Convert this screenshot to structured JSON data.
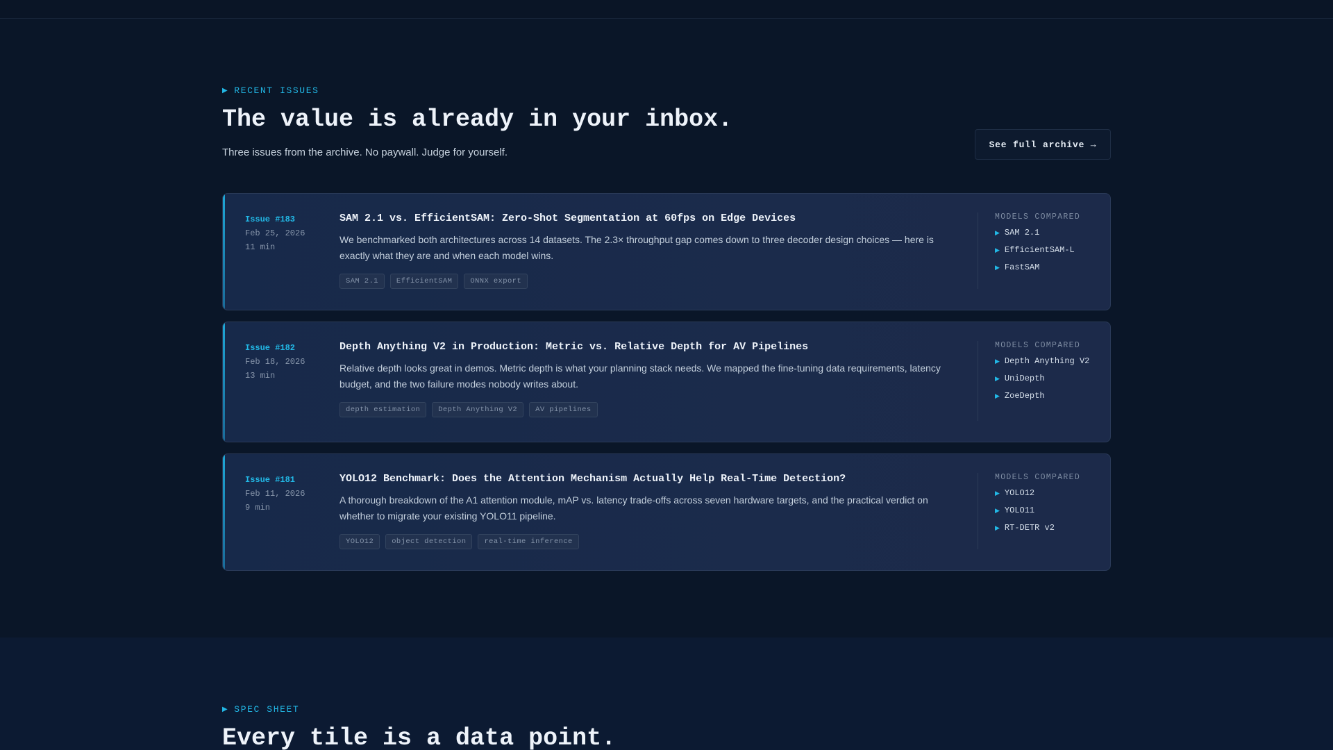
{
  "issues_section": {
    "eyebrow": "RECENT ISSUES",
    "headline": "The value is already in your inbox.",
    "subhead": "Three issues from the archive. No paywall. Judge for yourself.",
    "archive_button": "See full archive →",
    "models_header": "MODELS COMPARED",
    "cards": [
      {
        "issue": "Issue #183",
        "date": "Feb 25, 2026",
        "read_time": "11 min",
        "title": "SAM 2.1 vs. EfficientSAM: Zero-Shot Segmentation at 60fps on Edge Devices",
        "description": "We benchmarked both architectures across 14 datasets. The 2.3× throughput gap comes down to three decoder design choices — here is exactly what they are and when each model wins.",
        "tags": [
          "SAM 2.1",
          "EfficientSAM",
          "ONNX export"
        ],
        "models": [
          "SAM 2.1",
          "EfficientSAM-L",
          "FastSAM"
        ]
      },
      {
        "issue": "Issue #182",
        "date": "Feb 18, 2026",
        "read_time": "13 min",
        "title": "Depth Anything V2 in Production: Metric vs. Relative Depth for AV Pipelines",
        "description": "Relative depth looks great in demos. Metric depth is what your planning stack needs. We mapped the fine-tuning data requirements, latency budget, and the two failure modes nobody writes about.",
        "tags": [
          "depth estimation",
          "Depth Anything V2",
          "AV pipelines"
        ],
        "models": [
          "Depth Anything V2",
          "UniDepth",
          "ZoeDepth"
        ]
      },
      {
        "issue": "Issue #181",
        "date": "Feb 11, 2026",
        "read_time": "9 min",
        "title": "YOLO12 Benchmark: Does the Attention Mechanism Actually Help Real-Time Detection?",
        "description": "A thorough breakdown of the A1 attention module, mAP vs. latency trade-offs across seven hardware targets, and the practical verdict on whether to migrate your existing YOLO11 pipeline.",
        "tags": [
          "YOLO12",
          "object detection",
          "real-time inference"
        ],
        "models": [
          "YOLO12",
          "YOLO11",
          "RT-DETR v2"
        ]
      }
    ]
  },
  "spec_section": {
    "eyebrow": "SPEC SHEET",
    "headline": "Every tile is a data point."
  }
}
